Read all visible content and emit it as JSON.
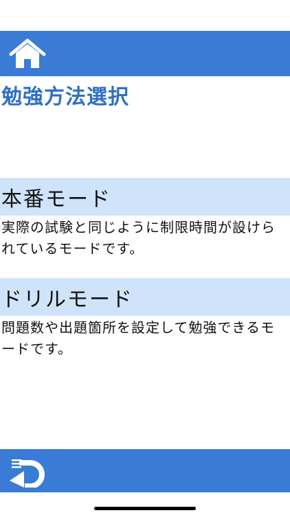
{
  "header": {
    "home_icon": "home-icon"
  },
  "page": {
    "title": "勉強方法選択"
  },
  "modes": [
    {
      "title": "本番モード",
      "description": "実際の試験と同じように制限時間が設けられているモードです。"
    },
    {
      "title": "ドリルモード",
      "description": "問題数や出題箇所を設定して勉強できるモードです。"
    }
  ],
  "footer": {
    "back_icon": "back-arrow-icon"
  },
  "colors": {
    "bar": "#3a7bd5",
    "title": "#2f6fc4",
    "section": "#cfe4fb"
  }
}
